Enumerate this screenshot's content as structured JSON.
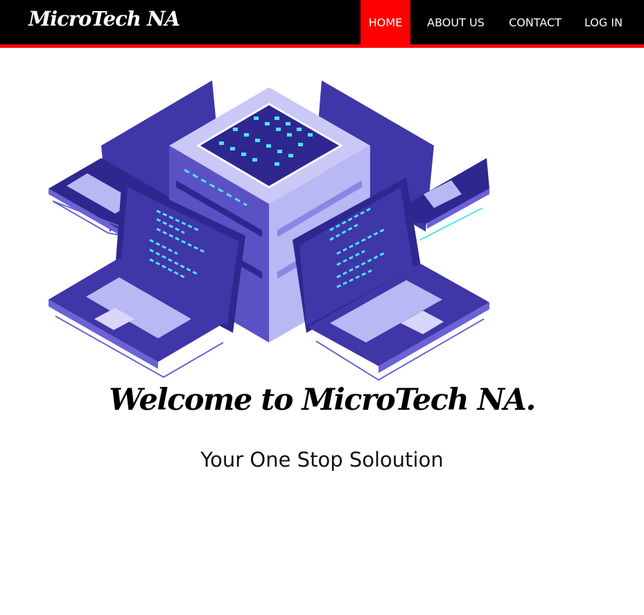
{
  "brand": {
    "name": "MicroTech NA"
  },
  "nav": {
    "items": [
      {
        "label": "HOME",
        "active": true
      },
      {
        "label": "ABOUT US",
        "active": false
      },
      {
        "label": "CONTACT",
        "active": false
      },
      {
        "label": "LOG IN",
        "active": false
      }
    ]
  },
  "hero": {
    "image_icon": "server-network-illustration-icon",
    "heading": "Welcome to MicroTech NA.",
    "tagline": "Your One Stop Soloution"
  },
  "colors": {
    "navbar_bg": "#000000",
    "accent": "#ff0000",
    "illustration_primary": "#3f36a8",
    "illustration_light": "#b8b8f4",
    "illustration_screen_code": "#4ee3f0"
  }
}
